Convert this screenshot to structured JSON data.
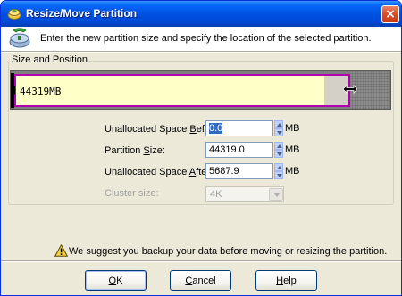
{
  "window": {
    "title": "Resize/Move Partition",
    "close_glyph": "×",
    "colors": {
      "titlebar": "#0054e3",
      "close": "#d9512c",
      "dialog_bg": "#ece9d8"
    }
  },
  "header": {
    "icon": "partition-tool-icon",
    "text": "Enter the new partition size and specify the location of the selected partition."
  },
  "group": {
    "label": "Size and Position",
    "partition_bar": {
      "label": "44319MB",
      "used_color": "#ffffc8",
      "border_color": "#b000b0",
      "unallocated_color": "#8c8c8c"
    }
  },
  "form": {
    "before": {
      "label_pre": "Unallocated Space ",
      "label_u": "B",
      "label_post": "efore:",
      "value": "0.0",
      "unit": "MB"
    },
    "size": {
      "label_pre": "Partition ",
      "label_u": "S",
      "label_post": "ize:",
      "value": "44319.0",
      "unit": "MB"
    },
    "after": {
      "label_pre": "Unallocated Space ",
      "label_u": "A",
      "label_post": "fter:",
      "value": "5687.9",
      "unit": "MB"
    },
    "cluster": {
      "label": "Cluster size:",
      "value": "4K",
      "disabled": true
    }
  },
  "warning": {
    "icon": "warning-icon",
    "text": "We suggest you backup your data before moving or resizing the partition."
  },
  "buttons": {
    "ok": {
      "u": "O",
      "rest": "K"
    },
    "cancel": {
      "u": "C",
      "rest": "ancel"
    },
    "help": {
      "u": "H",
      "rest": "elp"
    }
  }
}
